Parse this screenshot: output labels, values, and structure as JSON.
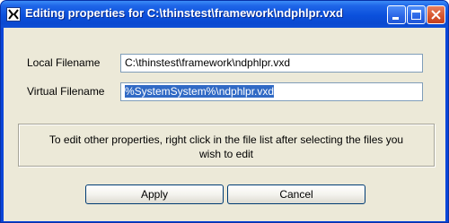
{
  "window": {
    "title": "Editing properties for C:\\thinstest\\framework\\ndphlpr.vxd"
  },
  "fields": {
    "local_label": "Local Filename",
    "local_value": "C:\\thinstest\\framework\\ndphlpr.vxd",
    "virtual_label": "Virtual Filename",
    "virtual_value": "%SystemSystem%\\ndphlpr.vxd"
  },
  "info": {
    "line1": "To edit other properties, right click in the file list after selecting the files you",
    "line2": "wish to edit"
  },
  "buttons": {
    "apply": "Apply",
    "cancel": "Cancel"
  },
  "icons": {
    "app": "app-icon",
    "minimize": "minimize-icon",
    "maximize": "maximize-icon",
    "close": "close-icon"
  },
  "colors": {
    "titlebar": "#0a49d0",
    "dialog_bg": "#ece9d8",
    "selection": "#316ac5",
    "close_button": "#d6542d"
  }
}
